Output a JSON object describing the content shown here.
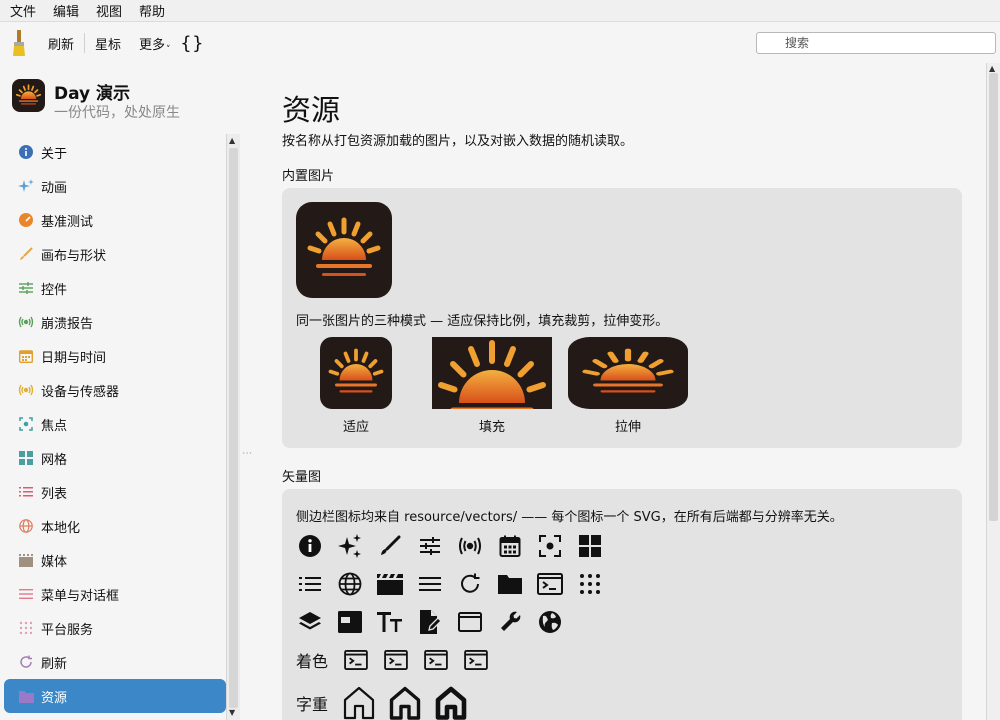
{
  "menu": [
    "文件",
    "编辑",
    "视图",
    "帮助"
  ],
  "toolbar": {
    "refresh_label": "刷新",
    "star_label": "星标",
    "more_label": "更多",
    "more_caret": "˅",
    "braces": "{}",
    "search_placeholder": "搜索"
  },
  "app": {
    "title": "Day 演示",
    "subtitle": "一份代码，处处原生"
  },
  "sidebar": {
    "items": [
      {
        "label": "关于",
        "icon": "info-icon",
        "color": "#3d6fb6"
      },
      {
        "label": "动画",
        "icon": "sparkles-icon",
        "color": "#5aa0d8"
      },
      {
        "label": "基准测试",
        "icon": "gauge-icon",
        "color": "#e8862a"
      },
      {
        "label": "画布与形状",
        "icon": "brush-icon",
        "color": "#e8a24a"
      },
      {
        "label": "控件",
        "icon": "sliders-icon",
        "color": "#5aa05a"
      },
      {
        "label": "崩溃报告",
        "icon": "broadcast-icon",
        "color": "#5aa05a"
      },
      {
        "label": "日期与时间",
        "icon": "calendar-icon",
        "color": "#e0a030"
      },
      {
        "label": "设备与传感器",
        "icon": "sensor-icon",
        "color": "#e0b030"
      },
      {
        "label": "焦点",
        "icon": "focus-icon",
        "color": "#3aa0a0"
      },
      {
        "label": "网格",
        "icon": "grid-icon",
        "color": "#4aa0a0"
      },
      {
        "label": "列表",
        "icon": "list-icon",
        "color": "#e05a6a"
      },
      {
        "label": "本地化",
        "icon": "globe-icon",
        "color": "#e07a5a"
      },
      {
        "label": "媒体",
        "icon": "film-icon",
        "color": "#a09080"
      },
      {
        "label": "菜单与对话框",
        "icon": "menu-icon",
        "color": "#e07a8a"
      },
      {
        "label": "平台服务",
        "icon": "dots-icon",
        "color": "#e0a0b0"
      },
      {
        "label": "刷新",
        "icon": "refresh-icon",
        "color": "#a07ab0"
      },
      {
        "label": "资源",
        "icon": "folder-icon",
        "color": "#9a7ac8",
        "active": true
      }
    ]
  },
  "main": {
    "title": "资源",
    "description": "按名称从打包资源加载的图片，以及对嵌入数据的随机读取。",
    "builtin_title": "内置图片",
    "modes_text": "同一张图片的三种模式 — 适应保持比例，填充裁剪，拉伸变形。",
    "modes": [
      "适应",
      "填充",
      "拉伸"
    ],
    "vector_title": "矢量图",
    "vector_text": "侧边栏图标均来自 resource/vectors/ —— 每个图标一个 SVG，在所有后端都与分辨率无关。",
    "tint_label": "着色",
    "weight_label": "字重"
  },
  "colors": {
    "accent": "#3b87c8",
    "sun_bg": "#231a17",
    "sun_orange": "#e8862a",
    "card_bg": "#e3e3e3"
  }
}
